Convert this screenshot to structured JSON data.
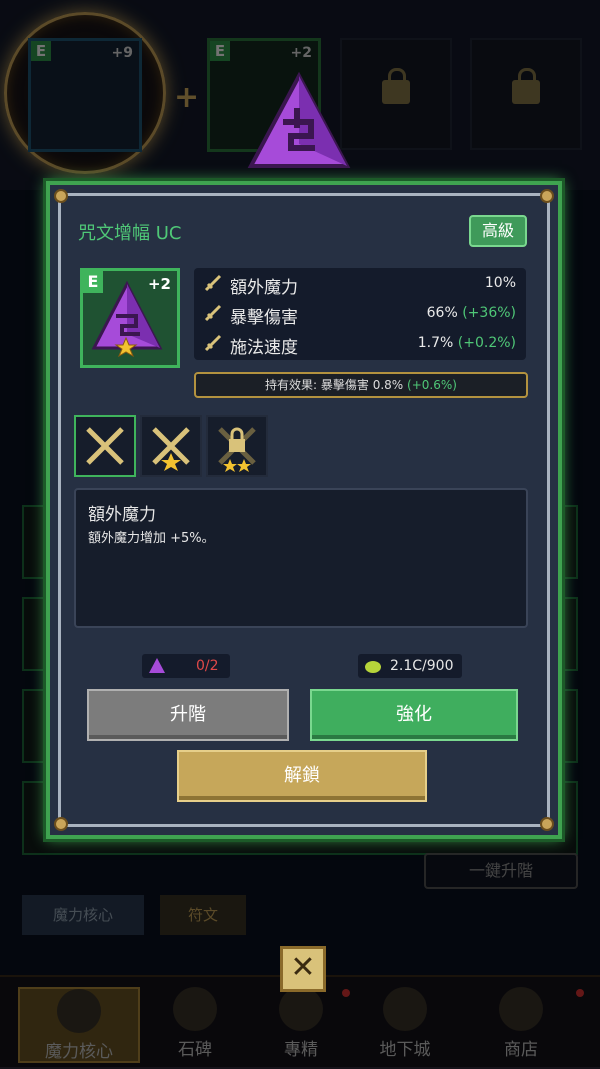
{
  "top_slots": {
    "slot1_grade": "E",
    "slot1_level": "+9",
    "slot2_grade": "E",
    "slot2_level": "+2",
    "plus": "+"
  },
  "dialog": {
    "title": "咒文增幅 UC",
    "grade_badge": "高級",
    "item": {
      "grade": "E",
      "level": "+2"
    },
    "stats": [
      {
        "name": "額外魔力",
        "value": "10%",
        "bonus": ""
      },
      {
        "name": "暴擊傷害",
        "value": "66%",
        "bonus": "(+36%)"
      },
      {
        "name": "施法速度",
        "value": "1.7%",
        "bonus": "(+0.2%)"
      }
    ],
    "held_effect": {
      "label": "持有效果: 暴擊傷害 0.8%",
      "bonus": "(+0.6%)"
    },
    "description": {
      "title": "額外魔力",
      "body": "額外魔力增加 +5%。"
    },
    "cost_rune": "0/2",
    "cost_gold": "2.1C/900",
    "buttons": {
      "advance": "升階",
      "enhance": "強化",
      "unlock": "解鎖"
    }
  },
  "background": {
    "one_key_advance": "一鍵升階",
    "tab_core": "魔力核心",
    "tab_rune": "符文",
    "close": "✕"
  },
  "nav": [
    {
      "label": "魔力核心"
    },
    {
      "label": "石碑"
    },
    {
      "label": "專精"
    },
    {
      "label": "地下城"
    },
    {
      "label": "商店"
    }
  ],
  "colors": {
    "accent_green": "#3fa350",
    "bonus_green": "#4fc777",
    "gold": "#c6a75a",
    "red": "#e04848"
  }
}
